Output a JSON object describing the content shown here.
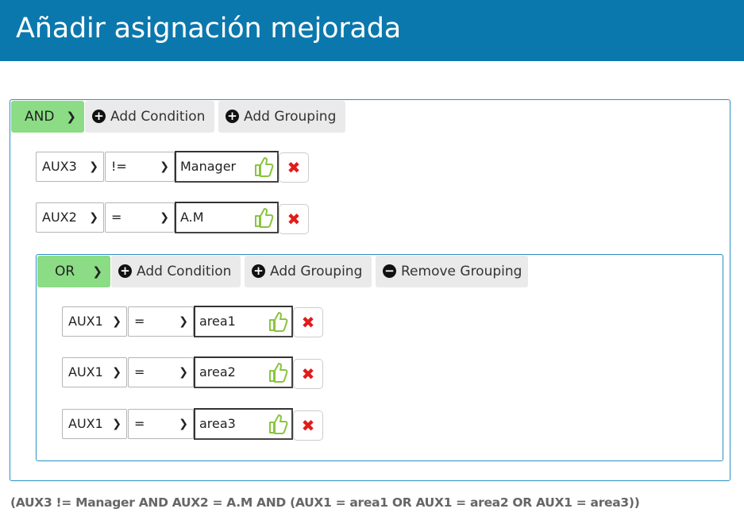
{
  "header": {
    "title": "Añadir asignación mejorada"
  },
  "icons": {
    "chevron": "chevron-down-icon",
    "plus": "plus-circle-icon",
    "minus": "minus-circle-icon",
    "thumb": "thumbs-up-icon",
    "delete": "close-icon"
  },
  "colors": {
    "header": "#0b78ad",
    "operator": "#8bdc84",
    "delete": "#e31b1b",
    "thumb": "#8ac43f"
  },
  "outer_group": {
    "operator": "AND",
    "add_condition_label": "Add Condition",
    "add_grouping_label": "Add Grouping",
    "conditions": [
      {
        "field": "AUX3",
        "operator": "!=",
        "value": "Manager"
      },
      {
        "field": "AUX2",
        "operator": "=",
        "value": "A.M"
      }
    ]
  },
  "inner_group": {
    "operator": "OR",
    "add_condition_label": "Add Condition",
    "add_grouping_label": "Add Grouping",
    "remove_grouping_label": "Remove Grouping",
    "conditions": [
      {
        "field": "AUX1",
        "operator": "=",
        "value": "area1"
      },
      {
        "field": "AUX1",
        "operator": "=",
        "value": "area2"
      },
      {
        "field": "AUX1",
        "operator": "=",
        "value": "area3"
      }
    ]
  },
  "summary": "(AUX3 != Manager AND AUX2 = A.M AND (AUX1 = area1 OR AUX1 = area2 OR AUX1 = area3))"
}
